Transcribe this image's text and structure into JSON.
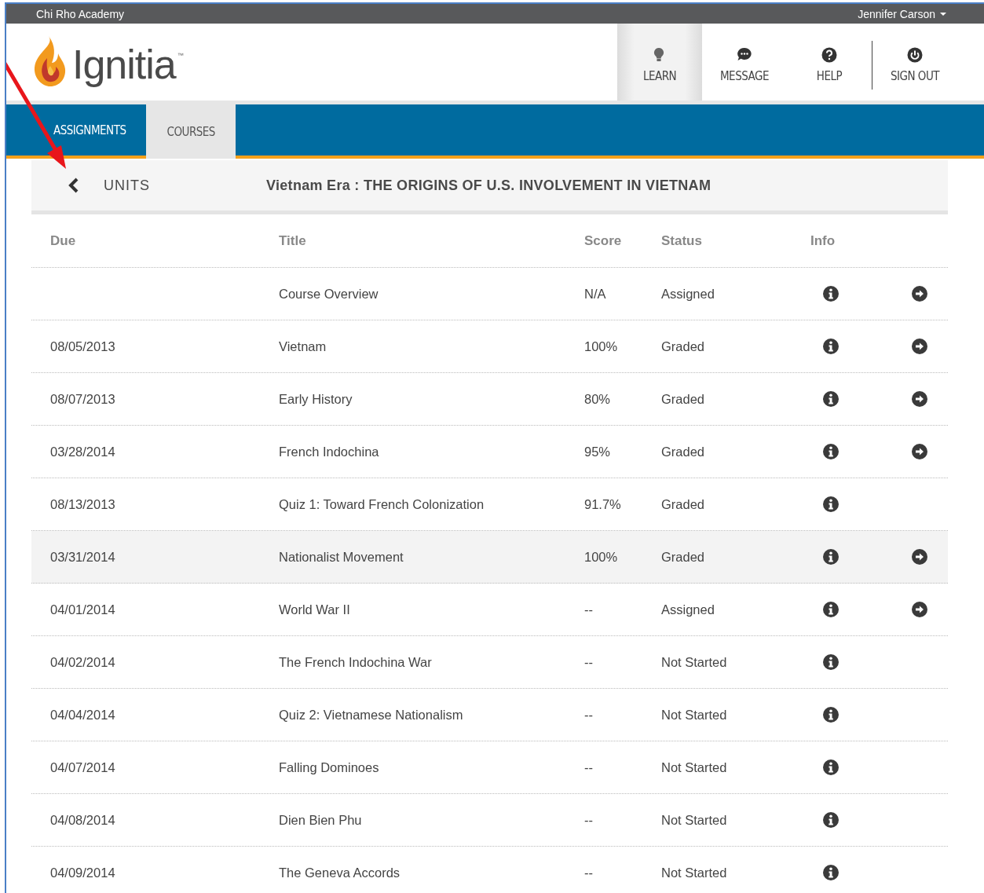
{
  "top_bar": {
    "school": "Chi Rho Academy",
    "user": "Jennifer Carson"
  },
  "logo": {
    "text": "Ignitia",
    "mark": "™"
  },
  "nav": [
    {
      "label": "LEARN",
      "kind": "bulb",
      "selected": true,
      "separated": false
    },
    {
      "label": "MESSAGE",
      "kind": "chat",
      "selected": false,
      "separated": false
    },
    {
      "label": "HELP",
      "kind": "help",
      "selected": false,
      "separated": false
    },
    {
      "label": "SIGN OUT",
      "kind": "power",
      "selected": false,
      "separated": true
    }
  ],
  "tabs": [
    {
      "label": "ASSIGNMENTS",
      "selected": false
    },
    {
      "label": "COURSES",
      "selected": true
    }
  ],
  "units_bar": {
    "back": "UNITS",
    "title": "Vietnam Era : THE ORIGINS OF U.S. INVOLVEMENT IN VIETNAM"
  },
  "table": {
    "columns": [
      "Due",
      "Title",
      "Score",
      "Status",
      "Info"
    ],
    "rows": [
      {
        "due": "",
        "title": "Course Overview",
        "score": "N/A",
        "status": "Assigned",
        "highlighted": false,
        "open_button": true
      },
      {
        "due": "08/05/2013",
        "title": "Vietnam",
        "score": "100%",
        "status": "Graded",
        "highlighted": false,
        "open_button": true
      },
      {
        "due": "08/07/2013",
        "title": "Early History",
        "score": "80%",
        "status": "Graded",
        "highlighted": false,
        "open_button": true
      },
      {
        "due": "03/28/2014",
        "title": "French Indochina",
        "score": "95%",
        "status": "Graded",
        "highlighted": false,
        "open_button": true
      },
      {
        "due": "08/13/2013",
        "title": "Quiz 1: Toward French Colonization",
        "score": "91.7%",
        "status": "Graded",
        "highlighted": false,
        "open_button": false
      },
      {
        "due": "03/31/2014",
        "title": "Nationalist Movement",
        "score": "100%",
        "status": "Graded",
        "highlighted": true,
        "open_button": true
      },
      {
        "due": "04/01/2014",
        "title": "World War II",
        "score": "--",
        "status": "Assigned",
        "highlighted": false,
        "open_button": true
      },
      {
        "due": "04/02/2014",
        "title": "The French Indochina War",
        "score": "--",
        "status": "Not Started",
        "highlighted": false,
        "open_button": false
      },
      {
        "due": "04/04/2014",
        "title": "Quiz 2: Vietnamese Nationalism",
        "score": "--",
        "status": "Not Started",
        "highlighted": false,
        "open_button": false
      },
      {
        "due": "04/07/2014",
        "title": "Falling Dominoes",
        "score": "--",
        "status": "Not Started",
        "highlighted": false,
        "open_button": false
      },
      {
        "due": "04/08/2014",
        "title": "Dien Bien Phu",
        "score": "--",
        "status": "Not Started",
        "highlighted": false,
        "open_button": false
      },
      {
        "due": "04/09/2014",
        "title": "The Geneva Accords",
        "score": "--",
        "status": "Not Started",
        "highlighted": false,
        "open_button": false
      }
    ]
  }
}
